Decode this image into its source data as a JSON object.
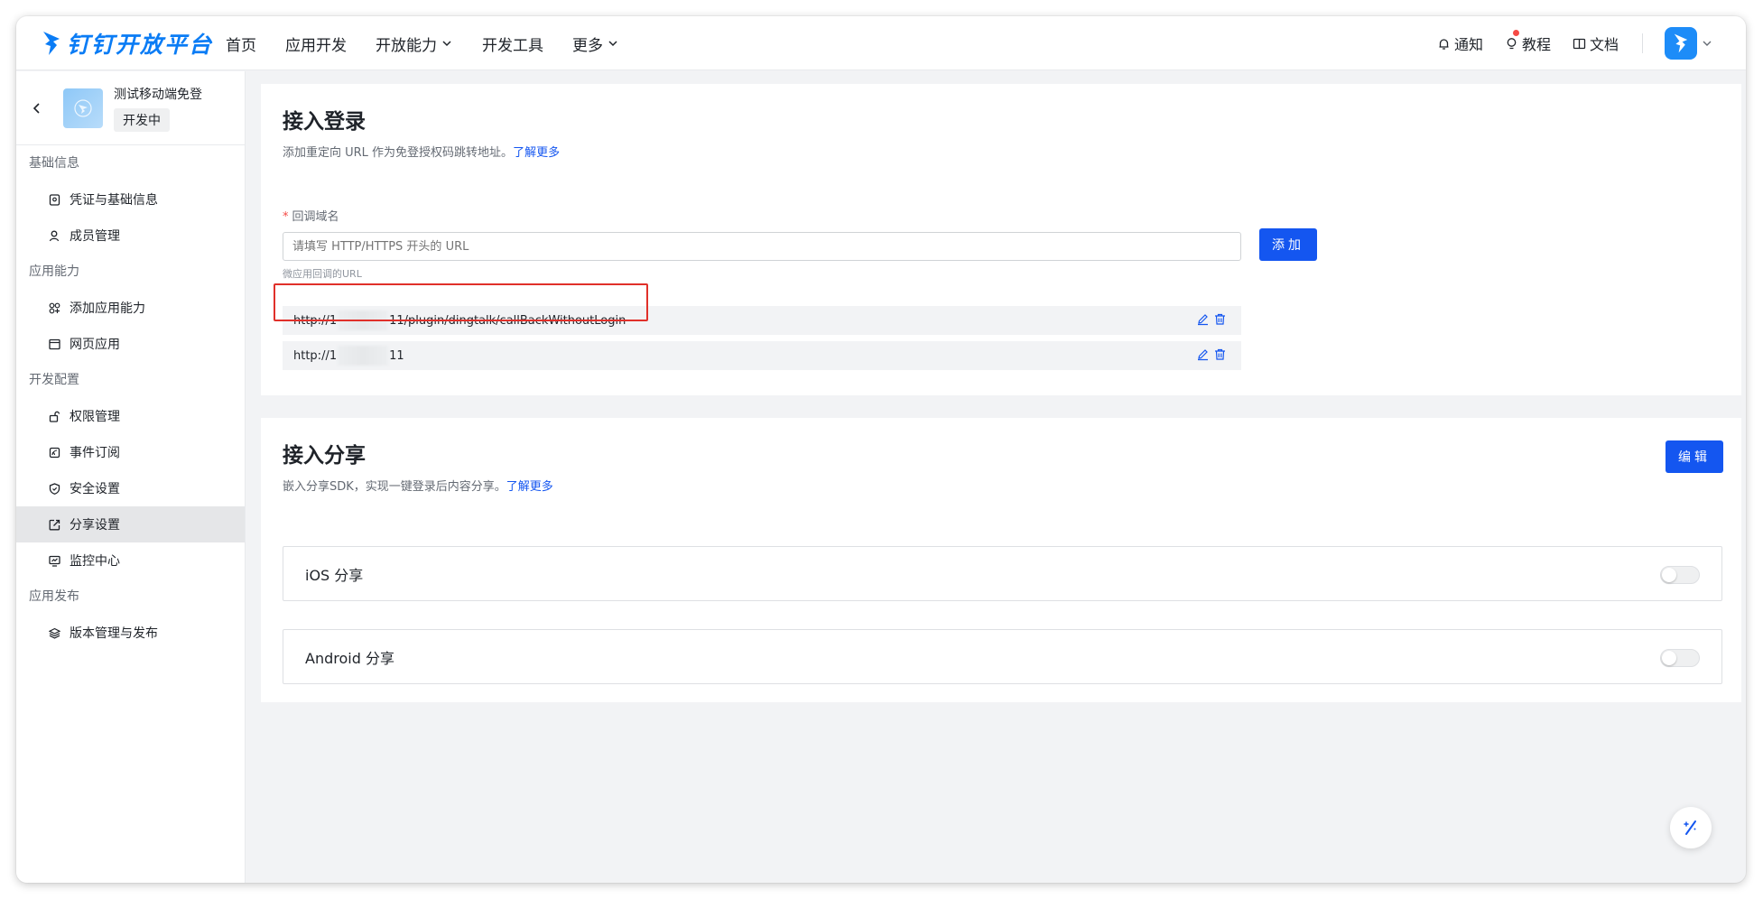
{
  "brand": {
    "logo_text": "钉钉开放平台",
    "color": "#0a7cf5"
  },
  "nav": {
    "items": [
      {
        "label": "首页",
        "has_chevron": false
      },
      {
        "label": "应用开发",
        "has_chevron": false
      },
      {
        "label": "开放能力",
        "has_chevron": true
      },
      {
        "label": "开发工具",
        "has_chevron": false
      },
      {
        "label": "更多",
        "has_chevron": true
      }
    ]
  },
  "nav_right": {
    "notify": "通知",
    "tutorial": "教程",
    "docs": "文档"
  },
  "app": {
    "name": "测试移动端免登",
    "status": "开发中"
  },
  "sidebar": {
    "sections": [
      {
        "title": "基础信息",
        "items": [
          {
            "label": "凭证与基础信息",
            "icon": "credential-icon"
          },
          {
            "label": "成员管理",
            "icon": "member-icon"
          }
        ]
      },
      {
        "title": "应用能力",
        "items": [
          {
            "label": "添加应用能力",
            "icon": "add-capability-icon"
          },
          {
            "label": "网页应用",
            "icon": "web-app-icon"
          }
        ]
      },
      {
        "title": "开发配置",
        "items": [
          {
            "label": "权限管理",
            "icon": "permission-icon"
          },
          {
            "label": "事件订阅",
            "icon": "event-icon"
          },
          {
            "label": "安全设置",
            "icon": "security-icon"
          },
          {
            "label": "分享设置",
            "icon": "share-icon",
            "active": true
          },
          {
            "label": "监控中心",
            "icon": "monitor-icon"
          }
        ]
      },
      {
        "title": "应用发布",
        "items": [
          {
            "label": "版本管理与发布",
            "icon": "version-icon"
          }
        ]
      }
    ]
  },
  "login_section": {
    "title": "接入登录",
    "description": "添加重定向 URL 作为免登授权码跳转地址。",
    "learn_more": "了解更多",
    "field_label": "回调域名",
    "input_placeholder": "请填写 HTTP/HTTPS 开头的 URL",
    "hint": "微应用回调的URL",
    "add_button": "添加",
    "urls": [
      {
        "prefix": "http://1",
        "suffix": "11/plugin/dingtalk/callBackWithoutLogin"
      },
      {
        "prefix": "http://1",
        "suffix": "11"
      }
    ]
  },
  "share_section": {
    "title": "接入分享",
    "description": "嵌入分享SDK，实现一键登录后内容分享。",
    "learn_more": "了解更多",
    "edit_button": "编辑",
    "cards": [
      {
        "label": "iOS 分享",
        "enabled": false
      },
      {
        "label": "Android 分享",
        "enabled": false
      }
    ]
  },
  "colors": {
    "primary": "#1456f0",
    "highlight": "#e0302a"
  }
}
